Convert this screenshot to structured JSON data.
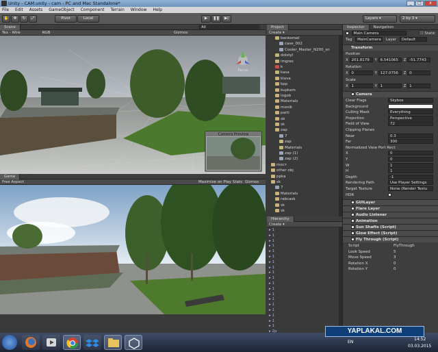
{
  "window": {
    "title": "Unity - CAM.unity - cam - PC and Mac Standalone*",
    "min": "_",
    "max": "□",
    "close": "x"
  },
  "menu": [
    "File",
    "Edit",
    "Assets",
    "GameObject",
    "Component",
    "Terrain",
    "Window",
    "Help"
  ],
  "toolbar": {
    "pivot": "Pivot",
    "local": "Local",
    "layers": "Layers",
    "layout": "2 by 3"
  },
  "scene": {
    "tab": "Scene",
    "mode": "Tex - Wire",
    "rgb": "RGB",
    "gizmos": "Gizmos",
    "search": "All",
    "persp": "Persp",
    "preview_title": "Camera Preview"
  },
  "game": {
    "tab": "Game",
    "aspect": "Free Aspect",
    "maximize": "Maximize on Play",
    "stats": "Stats",
    "gizmos": "Gizmos"
  },
  "project": {
    "tab": "Project",
    "create": "Create",
    "items": [
      {
        "name": "bankomat",
        "indent": 2,
        "type": "folder"
      },
      {
        "name": "case_002",
        "indent": 3,
        "type": "mesh"
      },
      {
        "name": "Cooler_Master_N200_sn",
        "indent": 3,
        "type": "mesh"
      },
      {
        "name": "dolstyl",
        "indent": 2,
        "type": "folder"
      },
      {
        "name": "imgres",
        "indent": 2,
        "type": "folder"
      },
      {
        "name": "k",
        "indent": 2,
        "type": "image"
      },
      {
        "name": "kasa",
        "indent": 2,
        "type": "folder"
      },
      {
        "name": "klava",
        "indent": 2,
        "type": "folder"
      },
      {
        "name": "kpp",
        "indent": 2,
        "type": "folder"
      },
      {
        "name": "kupkam",
        "indent": 2,
        "type": "folder"
      },
      {
        "name": "logob",
        "indent": 2,
        "type": "folder"
      },
      {
        "name": "Materials",
        "indent": 2,
        "type": "folder"
      },
      {
        "name": "monik",
        "indent": 2,
        "type": "folder"
      },
      {
        "name": "parti",
        "indent": 2,
        "type": "folder"
      },
      {
        "name": "sb",
        "indent": 2,
        "type": "folder"
      },
      {
        "name": "sk",
        "indent": 2,
        "type": "folder"
      },
      {
        "name": "zap",
        "indent": 2,
        "type": "folder"
      },
      {
        "name": "7",
        "indent": 3,
        "type": "mesh"
      },
      {
        "name": "zap",
        "indent": 3,
        "type": "folder"
      },
      {
        "name": "Materials",
        "indent": 3,
        "type": "folder"
      },
      {
        "name": "zap (1)",
        "indent": 3,
        "type": "mesh"
      },
      {
        "name": "zap (2)",
        "indent": 3,
        "type": "mesh"
      },
      {
        "name": "mост",
        "indent": 1,
        "type": "folder"
      },
      {
        "name": "other obj",
        "indent": 1,
        "type": "folder"
      },
      {
        "name": "ppka",
        "indent": 1,
        "type": "folder"
      },
      {
        "name": "sk",
        "indent": 1,
        "type": "folder"
      },
      {
        "name": "7",
        "indent": 2,
        "type": "mesh"
      },
      {
        "name": "Materials",
        "indent": 2,
        "type": "folder"
      },
      {
        "name": "rabcask",
        "indent": 2,
        "type": "folder"
      },
      {
        "name": "sk",
        "indent": 2,
        "type": "folder"
      },
      {
        "name": "sk",
        "indent": 2,
        "type": "folder"
      }
    ]
  },
  "hierarchy": {
    "tab": "Hierarchy",
    "create": "Create",
    "items": [
      "1",
      "1",
      "1",
      "1",
      "1",
      "1",
      "1",
      "1",
      "1",
      "1",
      "1",
      "1",
      "1",
      "1",
      "1",
      "1",
      "1",
      "1",
      "1",
      "2p"
    ]
  },
  "inspector": {
    "tabs": [
      "Inspector",
      "Navigation"
    ],
    "object_name": "Main Camera",
    "static": "Static",
    "tag_label": "Tag",
    "tag": "MainCamera",
    "layer_label": "Layer",
    "layer": "Default",
    "transform": {
      "title": "Transform",
      "position": {
        "label": "Position",
        "x": "201.8179",
        "y": "6.541065",
        "z": "-51.7743"
      },
      "rotation": {
        "label": "Rotation",
        "x": "0",
        "y": "127.0756",
        "z": "0"
      },
      "scale": {
        "label": "Scale",
        "x": "1",
        "y": "1",
        "z": "1"
      }
    },
    "camera": {
      "title": "Camera",
      "rows": [
        {
          "label": "Clear Flags",
          "value": "Skybox"
        },
        {
          "label": "Background",
          "value": ""
        },
        {
          "label": "Culling Mask",
          "value": "Everything"
        },
        {
          "label": "Projection",
          "value": "Perspective"
        },
        {
          "label": "Field of View",
          "value": "72"
        },
        {
          "label": "Clipping Planes",
          "value": ""
        },
        {
          "label": "Near",
          "value": "0.3"
        },
        {
          "label": "Far",
          "value": "300"
        },
        {
          "label": "Normalized View Port Rect",
          "value": ""
        },
        {
          "label": "X",
          "value": "0"
        },
        {
          "label": "Y",
          "value": "0"
        },
        {
          "label": "W",
          "value": "1"
        },
        {
          "label": "H",
          "value": "1"
        },
        {
          "label": "Depth",
          "value": "-1"
        },
        {
          "label": "Rendering Path",
          "value": "Use Player Settings"
        },
        {
          "label": "Target Texture",
          "value": "None (Render Textu"
        },
        {
          "label": "HDR",
          "value": ""
        }
      ]
    },
    "components": [
      "GUILayer",
      "Flare Layer",
      "Audio Listener",
      "Animation",
      "Sun Shafts (Script)",
      "Glow Effect (Script)",
      "Fly Through (Script)"
    ],
    "fly": [
      {
        "label": "Script",
        "value": "FlyThrough"
      },
      {
        "label": "Look Speed",
        "value": "5"
      },
      {
        "label": "Move Speed",
        "value": "3"
      },
      {
        "label": "Rotation X",
        "value": "0"
      },
      {
        "label": "Rotation Y",
        "value": "0"
      }
    ]
  },
  "taskbar": {
    "lang": "EN",
    "time": "14:52",
    "date": "03.03.2015",
    "watermark": "YAPLAKAL.COM"
  },
  "colors": {
    "taskbar": "#1d2535",
    "accent": "#6d93bd",
    "panel": "#3a3a3a"
  }
}
